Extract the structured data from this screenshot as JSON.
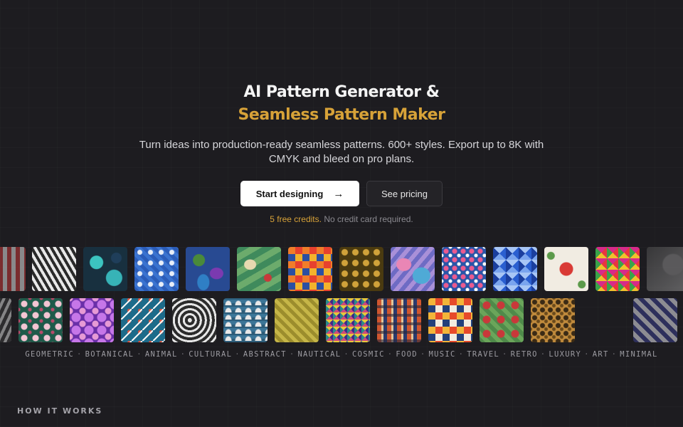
{
  "hero": {
    "title_line1": "AI Pattern Generator &",
    "title_line2": "Seamless Pattern Maker",
    "subtitle": "Turn ideas into production-ready seamless patterns. 600+ styles. Export up to 8K with CMYK and bleed on pro plans.",
    "primary_cta": "Start designing",
    "secondary_cta": "See pricing",
    "note_credits": "5 free credits.",
    "note_rest": "No credit card required."
  },
  "colors": {
    "accent_gold": "#d7a238",
    "background": "#1d1c20",
    "primary_button_bg": "#ffffff"
  },
  "gallery": {
    "row1_icons": [
      "pattern-tile-icon"
    ],
    "row2_icons": [
      "pattern-tile-icon"
    ]
  },
  "categories": [
    "GEOMETRIC",
    "BOTANICAL",
    "ANIMAL",
    "CULTURAL",
    "ABSTRACT",
    "NAUTICAL",
    "COSMIC",
    "FOOD",
    "MUSIC",
    "TRAVEL",
    "RETRO",
    "LUXURY",
    "ART",
    "MINIMAL"
  ],
  "category_separator": "·",
  "sections": {
    "how_it_works": "HOW IT WORKS"
  }
}
